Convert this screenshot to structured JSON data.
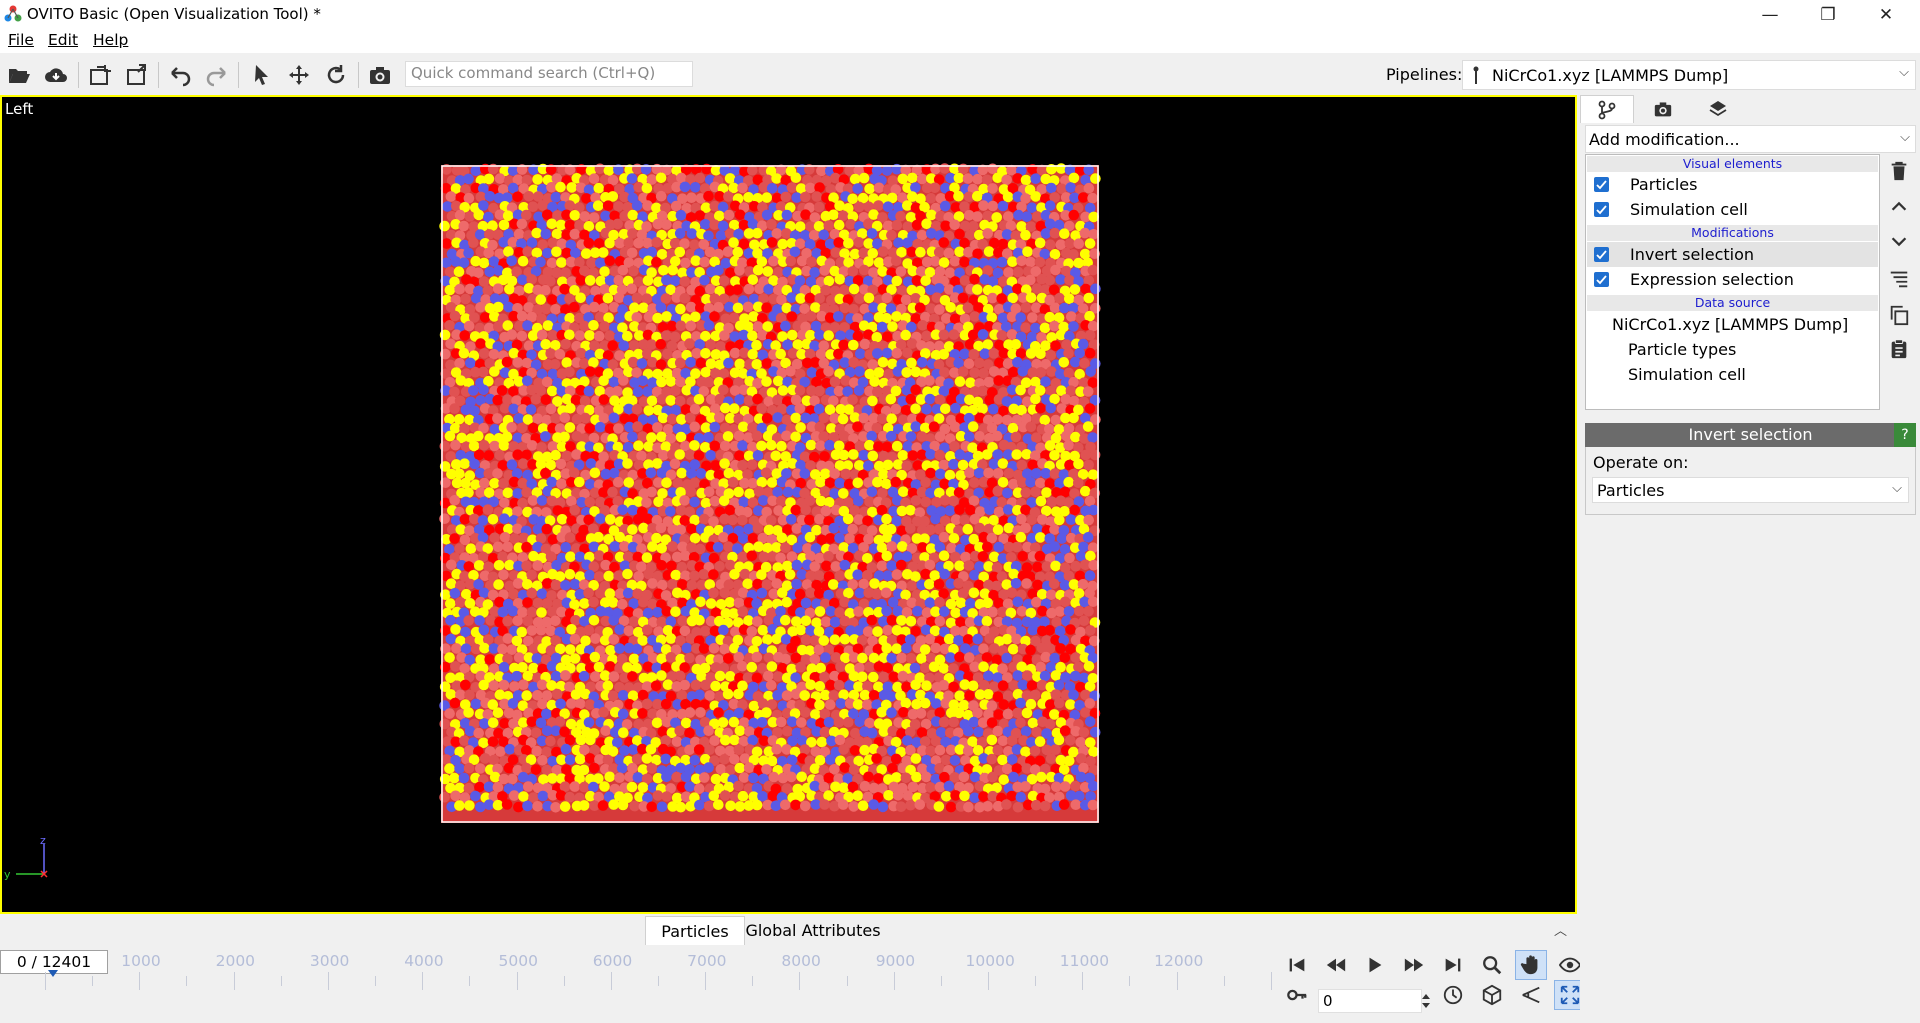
{
  "window": {
    "title": "OVITO Basic (Open Visualization Tool) *",
    "minimize": "—",
    "maximize": "❐",
    "close": "✕"
  },
  "menu": {
    "file": "File",
    "edit": "Edit",
    "help": "Help"
  },
  "toolbar": {
    "search_placeholder": "Quick command search (Ctrl+Q)",
    "pipelines_label": "Pipelines:",
    "pipeline_value": "NiCrCo1.xyz [LAMMPS Dump]"
  },
  "viewport": {
    "label": "Left",
    "axis_z": "z",
    "axis_y": "y",
    "particle_colors": [
      "#e05252",
      "#ee6a6a",
      "#ff0000",
      "#ffff00",
      "#5a5ae6"
    ]
  },
  "bottom_tabs": {
    "particles": "Particles",
    "global_attributes": "Global Attributes"
  },
  "timeline": {
    "frame": "0 / 12401",
    "ticks": [
      "1000",
      "2000",
      "3000",
      "4000",
      "5000",
      "6000",
      "7000",
      "8000",
      "9000",
      "10000",
      "11000",
      "12000"
    ],
    "current_frame": "0"
  },
  "right_panel": {
    "add_modification": "Add modification...",
    "groups": {
      "visual": "Visual elements",
      "modifications": "Modifications",
      "source": "Data source"
    },
    "visual_elements": [
      "Particles",
      "Simulation cell"
    ],
    "modifications": [
      "Invert selection",
      "Expression selection"
    ],
    "data_source": {
      "name": "NiCrCo1.xyz [LAMMPS Dump]",
      "children": [
        "Particle types",
        "Simulation cell"
      ]
    },
    "rollout": {
      "title": "Invert selection",
      "help": "?",
      "operate_on_label": "Operate on:",
      "operate_on_value": "Particles"
    }
  }
}
